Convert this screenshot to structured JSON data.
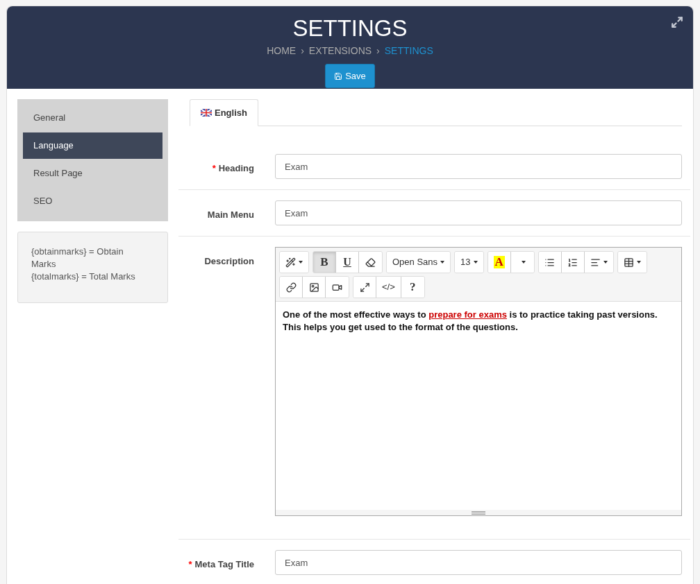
{
  "header": {
    "title": "SETTINGS",
    "breadcrumb": [
      {
        "label": "HOME",
        "selected": false
      },
      {
        "label": "EXTENSIONS",
        "selected": false
      },
      {
        "label": "SETTINGS",
        "selected": true
      }
    ],
    "separator": "›",
    "save_button": "Save"
  },
  "sidebar": {
    "items": [
      {
        "label": "General",
        "selected": false
      },
      {
        "label": "Language",
        "selected": true
      },
      {
        "label": "Result Page",
        "selected": false
      },
      {
        "label": "SEO",
        "selected": false
      }
    ],
    "note": [
      "{obtainmarks} = Obtain Marks",
      "{totalmarks} = Total Marks"
    ]
  },
  "tabs": [
    {
      "label": "English",
      "selected": true
    }
  ],
  "fields": [
    {
      "label": "Heading",
      "required_mark": "*",
      "kind": "input",
      "value": "Exam"
    },
    {
      "label": "Main Menu",
      "kind": "input",
      "value": "Exam"
    },
    {
      "label": "Description",
      "kind": "editor"
    },
    {
      "label": "Meta Tag Title",
      "required_mark": "*",
      "kind": "input",
      "value": "Exam"
    }
  ],
  "editor": {
    "toolbar": [
      [
        {
          "active": false
        }
      ],
      [
        {
          "text": "B",
          "active": true
        },
        {
          "text": "U",
          "active": false
        },
        {
          "active": false
        }
      ],
      [
        {
          "text": "Open Sans",
          "active": false
        }
      ],
      [
        {
          "text": "13",
          "active": false
        }
      ],
      [
        {
          "text": "A",
          "active": false
        },
        {
          "active": false
        }
      ],
      [
        {
          "active": false
        },
        {
          "active": false
        },
        {
          "active": false
        }
      ],
      [
        {
          "active": false
        }
      ],
      [
        {
          "active": false
        },
        {
          "active": false
        },
        {
          "active": false
        }
      ],
      [
        {
          "active": false
        },
        {
          "text": "</>",
          "active": false
        },
        {
          "text": "?",
          "active": false
        }
      ]
    ],
    "content": [
      {
        "kind": "text",
        "text": "One of the most effective ways to "
      },
      {
        "kind": "link",
        "text": "prepare for exams"
      },
      {
        "kind": "text",
        "text": " is to practice taking past versions. This helps you get used to the format of the questions."
      }
    ]
  }
}
